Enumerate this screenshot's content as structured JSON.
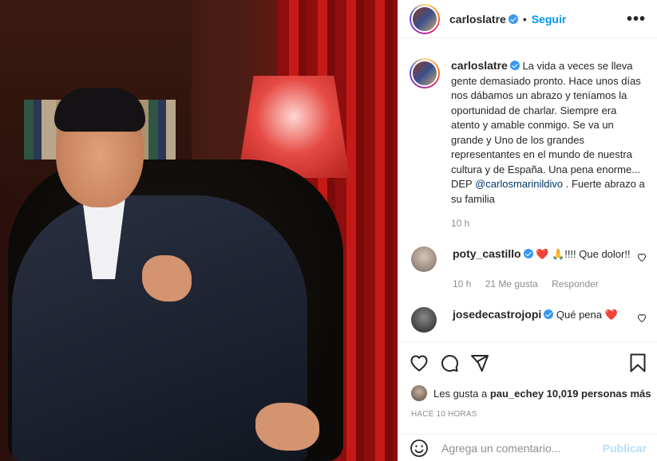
{
  "header": {
    "username": "carloslatre",
    "follow_label": "Seguir",
    "more_label": "•••"
  },
  "caption": {
    "username": "carloslatre",
    "text_before_mention": "La vida a veces se lleva gente demasiado pronto. Hace unos días nos dábamos un abrazo y teníamos la oportunidad de charlar. Siempre era atento y amable conmigo. Se va un grande y Uno de los grandes representantes en el mundo de nuestra cultura y de España. Una pena enorme... DEP ",
    "mention": "@carlosmarinildivo",
    "text_after_mention": " . Fuerte abrazo a su familia",
    "time": "10 h"
  },
  "comments": [
    {
      "username": "poty_castillo",
      "text": "❤️ 🙏!!!! Que dolor!!",
      "time": "10 h",
      "likes": "21 Me gusta",
      "reply_label": "Responder"
    },
    {
      "username": "josedecastrojopi",
      "text": "Qué pena ❤️"
    }
  ],
  "likes": {
    "prefix": "Les gusta a ",
    "user": "pau_eche",
    "suffix": " y 10,019 personas más"
  },
  "ago": "HACE 10 HORAS",
  "add_comment": {
    "placeholder": "Agrega un comentario...",
    "publish_label": "Publicar"
  },
  "colors": {
    "link": "#0095f6",
    "verified": "#3897f0",
    "heart": "#ed2b3c"
  }
}
